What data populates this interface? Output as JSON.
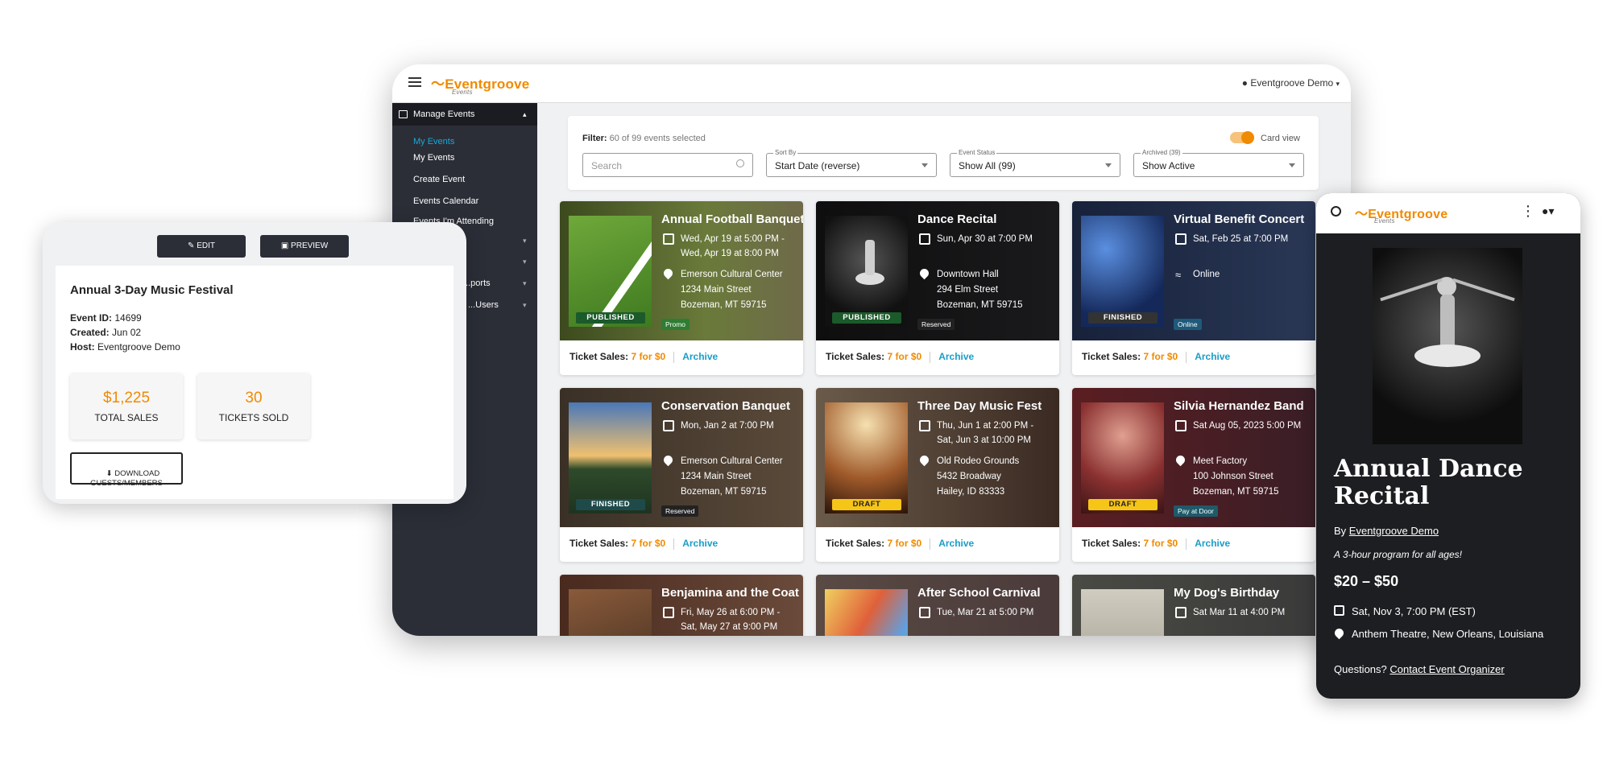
{
  "brand": {
    "name": "Eventgroove",
    "sub": "Events",
    "accent": "#f08a00",
    "link": "#1a9dc8"
  },
  "desktop": {
    "user": "Eventgroove Demo",
    "sidebar": {
      "header": "Manage Events",
      "items": [
        "My Events",
        "My Events",
        "Create Event",
        "Events Calendar",
        "Events I'm Attending"
      ],
      "sections": [
        "",
        "",
        "...ports",
        "...Users"
      ]
    },
    "filter": {
      "label": "Filter:",
      "summary": "60 of 99 events selected",
      "toggle": "Card view",
      "search_placeholder": "Search",
      "sort": {
        "label": "Sort By",
        "value": "Start Date (reverse)"
      },
      "status": {
        "label": "Event Status",
        "value": "Show All (99)"
      },
      "archived": {
        "label": "Archived (39)",
        "value": "Show Active"
      }
    },
    "cards": [
      {
        "title": "Annual Football Banquet",
        "date": "Wed, Apr 19 at 5:00 PM -\nWed, Apr 19 at 8:00 PM",
        "loc": "Emerson Cultural Center\n1234 Main Street\nBozeman, MT 59715",
        "status": "PUBLISHED",
        "tag": "Promo",
        "sales": "Ticket Sales:",
        "amt": "7 for $0",
        "archive": "Archive"
      },
      {
        "title": "Dance Recital",
        "date": "Sun, Apr 30 at 7:00 PM",
        "loc": "Downtown Hall\n294 Elm Street\nBozeman, MT 59715",
        "status": "PUBLISHED",
        "tag": "Reserved",
        "sales": "Ticket Sales:",
        "amt": "7 for $0",
        "archive": "Archive"
      },
      {
        "title": "Virtual Benefit Concert",
        "date": "Sat, Feb 25 at 7:00 PM",
        "loc": "Online",
        "status": "FINISHED",
        "tag": "Online",
        "sales": "Ticket Sales:",
        "amt": "7 for $0",
        "archive": "Archive"
      },
      {
        "title": "Conservation Banquet",
        "date": "Mon, Jan 2 at 7:00 PM",
        "loc": "Emerson Cultural Center\n1234 Main Street\nBozeman, MT 59715",
        "status": "FINISHED",
        "tag": "Reserved",
        "sales": "Ticket Sales:",
        "amt": "7 for $0",
        "archive": "Archive"
      },
      {
        "title": "Three Day Music Fest",
        "date": "Thu, Jun 1 at 2:00 PM -\nSat, Jun 3 at 10:00 PM",
        "loc": "Old Rodeo Grounds\n5432 Broadway\nHailey, ID 83333",
        "status": "DRAFT",
        "tag": "",
        "sales": "Ticket Sales:",
        "amt": "7 for $0",
        "archive": "Archive"
      },
      {
        "title": "Silvia Hernandez Band",
        "date": "Sat Aug 05, 2023 5:00 PM",
        "loc": "Meet Factory\n100 Johnson Street\nBozeman, MT 59715",
        "status": "DRAFT",
        "tag": "Pay at Door",
        "sales": "Ticket Sales:",
        "amt": "7 for $0",
        "archive": "Archive"
      },
      {
        "title": "Benjamina and the Coat",
        "date": "Fri, May 26 at 6:00 PM -\nSat, May 27 at 9:00 PM",
        "loc": "",
        "status": "",
        "tag": "",
        "sales": "",
        "amt": "",
        "archive": ""
      },
      {
        "title": "After School Carnival",
        "date": "Tue, Mar 21 at 5:00 PM",
        "loc": "",
        "status": "",
        "tag": "",
        "sales": "",
        "amt": "",
        "archive": ""
      },
      {
        "title": "My Dog's Birthday",
        "date": "Sat Mar 11 at 4:00 PM",
        "loc": "",
        "status": "",
        "tag": "",
        "sales": "",
        "amt": "",
        "archive": ""
      }
    ]
  },
  "panel": {
    "edit": "EDIT",
    "preview": "PREVIEW",
    "title": "Annual 3-Day Music Festival",
    "id_label": "Event ID:",
    "id": "14699",
    "created_label": "Created:",
    "created": "Jun 02",
    "host_label": "Host:",
    "host": "Eventgroove Demo",
    "total_sales": "$1,225",
    "total_sales_label": "TOTAL SALES",
    "tickets": "30",
    "tickets_label": "TICKETS SOLD",
    "download": "DOWNLOAD\nGUESTS/MEMBERS"
  },
  "phone": {
    "title": "Annual Dance Recital",
    "by": "By",
    "host": "Eventgroove Demo",
    "tagline": "A 3-hour program for all ages!",
    "price": "$20 – $50",
    "date": "Sat, Nov 3, 7:00 PM (EST)",
    "venue": "Anthem Theatre, New Orleans, Louisiana",
    "q": "Questions?",
    "contact": "Contact Event Organizer"
  }
}
